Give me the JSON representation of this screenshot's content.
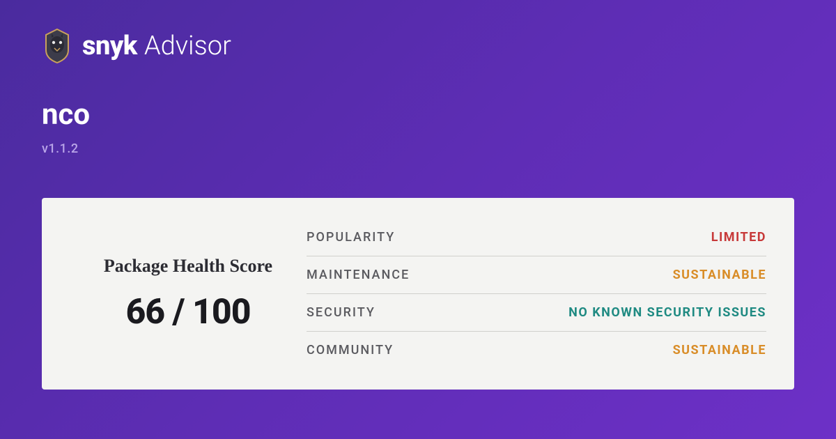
{
  "brand": {
    "bold": "snyk",
    "light": "Advisor"
  },
  "package": {
    "name": "nco",
    "version": "v1.1.2"
  },
  "score": {
    "title": "Package Health Score",
    "value": "66 / 100"
  },
  "metrics": [
    {
      "label": "POPULARITY",
      "value": "LIMITED",
      "cls": "clr-limited"
    },
    {
      "label": "MAINTENANCE",
      "value": "SUSTAINABLE",
      "cls": "clr-sustainable"
    },
    {
      "label": "SECURITY",
      "value": "NO KNOWN SECURITY ISSUES",
      "cls": "clr-secure"
    },
    {
      "label": "COMMUNITY",
      "value": "SUSTAINABLE",
      "cls": "clr-sustainable"
    }
  ]
}
